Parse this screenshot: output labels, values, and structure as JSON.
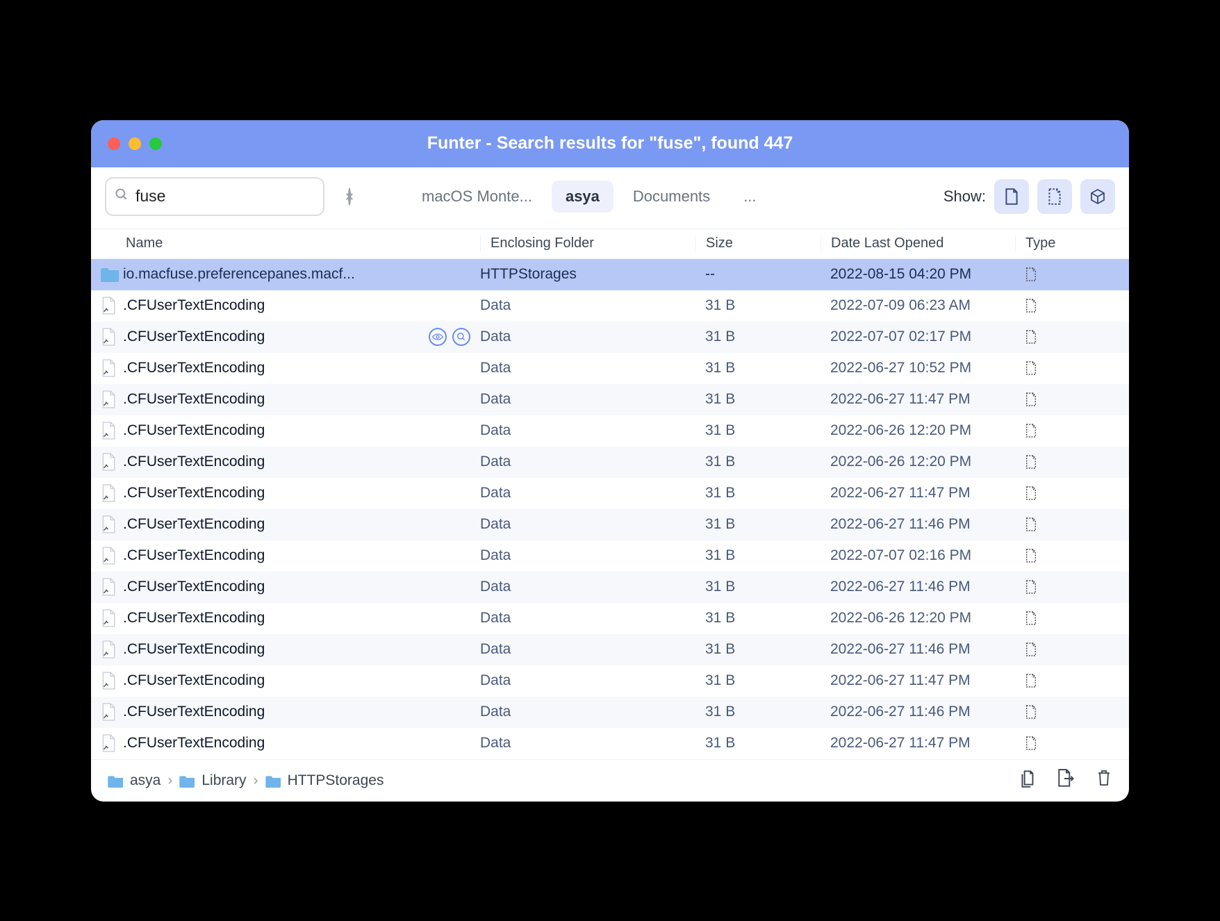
{
  "title": "Funter - Search results for \"fuse\", found 447",
  "search": {
    "value": "fuse"
  },
  "scopes": [
    {
      "label": "macOS Monte...",
      "active": false
    },
    {
      "label": "asya",
      "active": true
    },
    {
      "label": "Documents",
      "active": false
    },
    {
      "label": "...",
      "active": false
    }
  ],
  "show_label": "Show:",
  "columns": {
    "name": "Name",
    "folder": "Enclosing Folder",
    "size": "Size",
    "date": "Date Last Opened",
    "type": "Type"
  },
  "rows": [
    {
      "icon": "folder",
      "name": "io.macfuse.preferencepanes.macf...",
      "folder": "HTTPStorages",
      "size": "--",
      "date": "2022-08-15 04:20 PM",
      "type": "hidden",
      "selected": true,
      "actions": false
    },
    {
      "icon": "file",
      "name": ".CFUserTextEncoding",
      "folder": "Data",
      "size": "31 B",
      "date": "2022-07-09 06:23 AM",
      "type": "hidden",
      "actions": false
    },
    {
      "icon": "file",
      "name": ".CFUserTextEncoding",
      "folder": "Data",
      "size": "31 B",
      "date": "2022-07-07 02:17 PM",
      "type": "hidden",
      "actions": true
    },
    {
      "icon": "file",
      "name": ".CFUserTextEncoding",
      "folder": "Data",
      "size": "31 B",
      "date": "2022-06-27 10:52 PM",
      "type": "hidden",
      "actions": false
    },
    {
      "icon": "file",
      "name": ".CFUserTextEncoding",
      "folder": "Data",
      "size": "31 B",
      "date": "2022-06-27 11:47 PM",
      "type": "hidden",
      "actions": false
    },
    {
      "icon": "file",
      "name": ".CFUserTextEncoding",
      "folder": "Data",
      "size": "31 B",
      "date": "2022-06-26 12:20 PM",
      "type": "hidden",
      "actions": false
    },
    {
      "icon": "file",
      "name": ".CFUserTextEncoding",
      "folder": "Data",
      "size": "31 B",
      "date": "2022-06-26 12:20 PM",
      "type": "hidden",
      "actions": false
    },
    {
      "icon": "file",
      "name": ".CFUserTextEncoding",
      "folder": "Data",
      "size": "31 B",
      "date": "2022-06-27 11:47 PM",
      "type": "hidden",
      "actions": false
    },
    {
      "icon": "file",
      "name": ".CFUserTextEncoding",
      "folder": "Data",
      "size": "31 B",
      "date": "2022-06-27 11:46 PM",
      "type": "hidden",
      "actions": false
    },
    {
      "icon": "file",
      "name": ".CFUserTextEncoding",
      "folder": "Data",
      "size": "31 B",
      "date": "2022-07-07 02:16 PM",
      "type": "hidden",
      "actions": false
    },
    {
      "icon": "file",
      "name": ".CFUserTextEncoding",
      "folder": "Data",
      "size": "31 B",
      "date": "2022-06-27 11:46 PM",
      "type": "hidden",
      "actions": false
    },
    {
      "icon": "file",
      "name": ".CFUserTextEncoding",
      "folder": "Data",
      "size": "31 B",
      "date": "2022-06-26 12:20 PM",
      "type": "hidden",
      "actions": false
    },
    {
      "icon": "file",
      "name": ".CFUserTextEncoding",
      "folder": "Data",
      "size": "31 B",
      "date": "2022-06-27 11:46 PM",
      "type": "hidden",
      "actions": false
    },
    {
      "icon": "file",
      "name": ".CFUserTextEncoding",
      "folder": "Data",
      "size": "31 B",
      "date": "2022-06-27 11:47 PM",
      "type": "hidden",
      "actions": false
    },
    {
      "icon": "file",
      "name": ".CFUserTextEncoding",
      "folder": "Data",
      "size": "31 B",
      "date": "2022-06-27 11:46 PM",
      "type": "hidden",
      "actions": false
    },
    {
      "icon": "file",
      "name": ".CFUserTextEncoding",
      "folder": "Data",
      "size": "31 B",
      "date": "2022-06-27 11:47 PM",
      "type": "hidden",
      "actions": false
    }
  ],
  "path": [
    {
      "label": "asya"
    },
    {
      "label": "Library"
    },
    {
      "label": "HTTPStorages"
    }
  ]
}
